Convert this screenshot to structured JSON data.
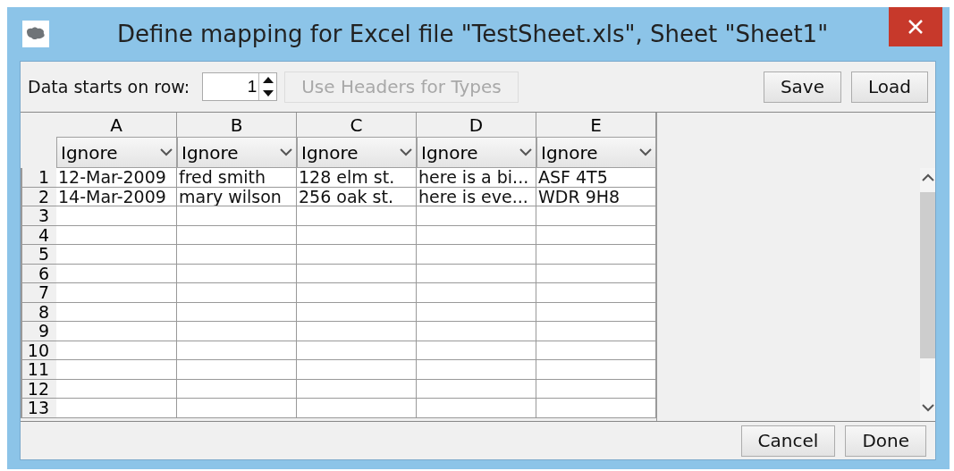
{
  "window": {
    "title": "Define mapping for Excel file \"TestSheet.xls\", Sheet \"Sheet1\""
  },
  "toolbar": {
    "label": "Data starts on row:",
    "start_row": "1",
    "headers_button": {
      "label": "Use Headers for Types",
      "disabled": true
    },
    "buttons": [
      "Save",
      "Load"
    ]
  },
  "table": {
    "columns": [
      {
        "letter": "A",
        "type": "Ignore"
      },
      {
        "letter": "B",
        "type": "Ignore"
      },
      {
        "letter": "C",
        "type": "Ignore"
      },
      {
        "letter": "D",
        "type": "Ignore"
      },
      {
        "letter": "E",
        "type": "Ignore"
      }
    ],
    "rows": [
      {
        "number": "1",
        "cells": [
          "12-Mar-2009",
          "fred smith",
          "128 elm st.",
          "here is a bi...",
          "ASF 4T5"
        ]
      },
      {
        "number": "2",
        "cells": [
          "14-Mar-2009",
          "mary wilson",
          "256 oak st.",
          "here is eve...",
          "WDR 9H8"
        ]
      },
      {
        "number": "3"
      },
      {
        "number": "4"
      },
      {
        "number": "5"
      },
      {
        "number": "6"
      },
      {
        "number": "7"
      },
      {
        "number": "8"
      },
      {
        "number": "9"
      },
      {
        "number": "10"
      },
      {
        "number": "11"
      },
      {
        "number": "12"
      },
      {
        "number": "13"
      }
    ]
  },
  "footer": {
    "buttons": [
      "Cancel",
      "Done"
    ]
  }
}
